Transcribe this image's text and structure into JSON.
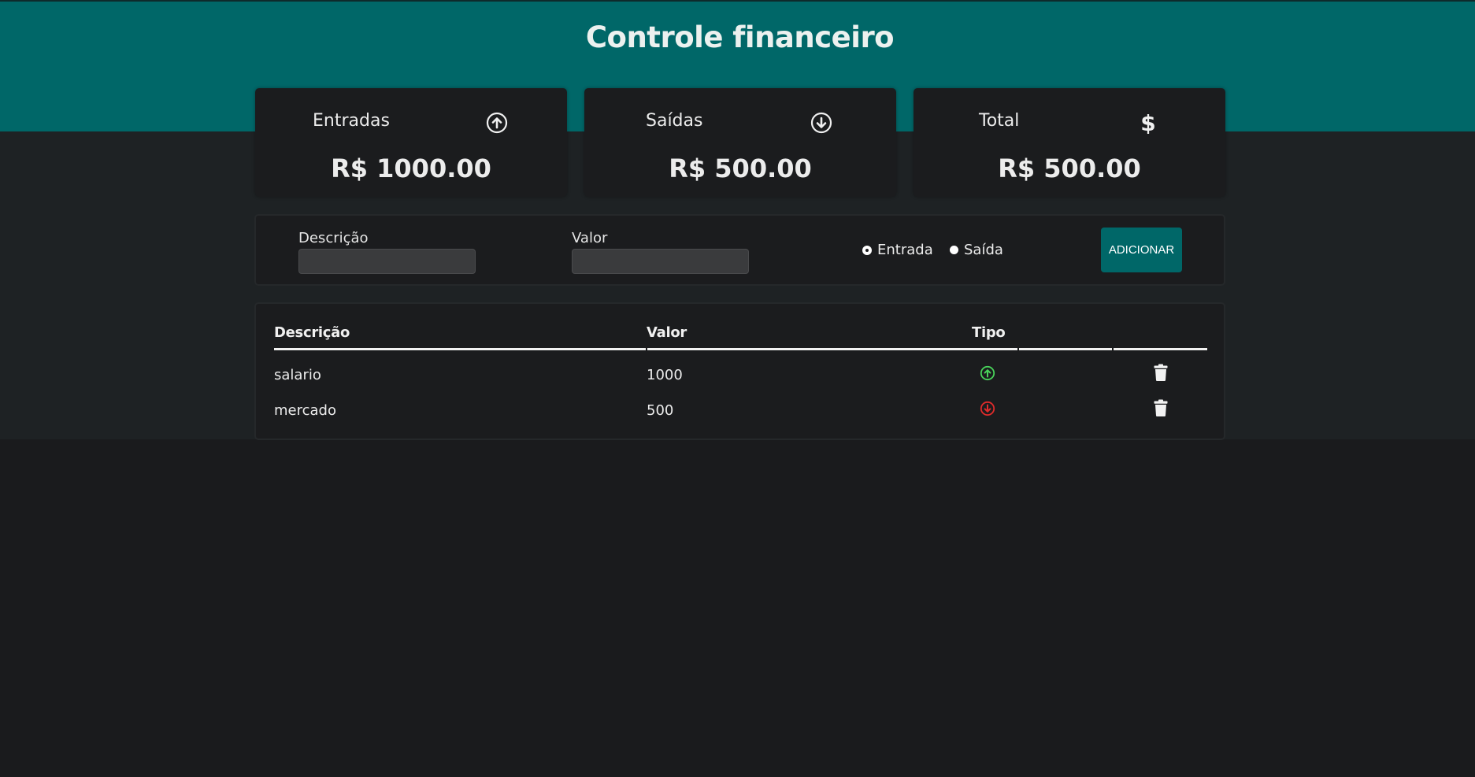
{
  "header": {
    "title": "Controle financeiro"
  },
  "summary": {
    "income": {
      "label": "Entradas",
      "value": "R$ 1000.00",
      "icon": "arrow-up-circle-icon"
    },
    "expense": {
      "label": "Saídas",
      "value": "R$ 500.00",
      "icon": "arrow-down-circle-icon"
    },
    "total": {
      "label": "Total",
      "value": "R$ 500.00",
      "icon": "dollar-icon"
    }
  },
  "form": {
    "description_label": "Descrição",
    "description_value": "",
    "amount_label": "Valor",
    "amount_value": "",
    "type_options": [
      "Entrada",
      "Saída"
    ],
    "selected_type": "Entrada",
    "add_button_label": "ADICIONAR"
  },
  "table": {
    "headers": [
      "Descrição",
      "Valor",
      "Tipo"
    ],
    "rows": [
      {
        "description": "salario",
        "amount": "1000",
        "type": "income",
        "type_icon": "arrow-up-circle-icon"
      },
      {
        "description": "mercado",
        "amount": "500",
        "type": "expense",
        "type_icon": "arrow-down-circle-icon"
      }
    ]
  },
  "colors": {
    "primary": "#006768",
    "background": "#1a1b1d",
    "income": "#49d35a",
    "expense": "#e02b2b"
  }
}
